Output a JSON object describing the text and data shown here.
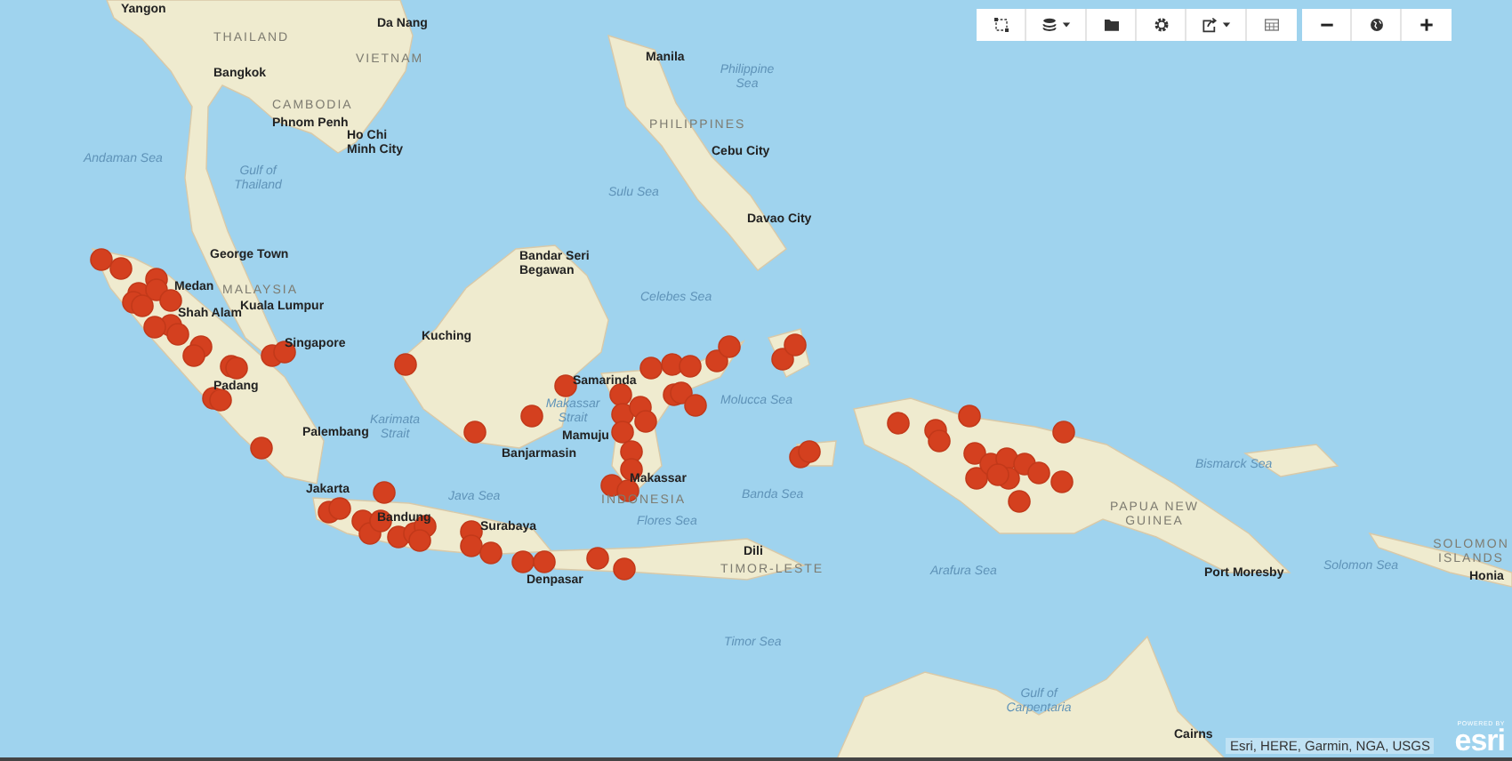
{
  "map": {
    "labels": [
      {
        "text": "Yangon",
        "kind": "city"
      },
      {
        "text": "Da Nang",
        "kind": "city"
      },
      {
        "text": "THAILAND",
        "kind": "country"
      },
      {
        "text": "VIETNAM",
        "kind": "country"
      },
      {
        "text": "Bangkok",
        "kind": "city"
      },
      {
        "text": "CAMBODIA",
        "kind": "country"
      },
      {
        "text": "Phnom Penh",
        "kind": "city"
      },
      {
        "text": "Ho Chi Minh City",
        "kind": "city"
      },
      {
        "text": "Andaman Sea",
        "kind": "sea"
      },
      {
        "text": "Gulf of Thailand",
        "kind": "sea"
      },
      {
        "text": "Manila",
        "kind": "city"
      },
      {
        "text": "Philippine Sea",
        "kind": "sea"
      },
      {
        "text": "PHILIPPINES",
        "kind": "country"
      },
      {
        "text": "Cebu City",
        "kind": "city"
      },
      {
        "text": "Sulu Sea",
        "kind": "sea"
      },
      {
        "text": "Davao City",
        "kind": "city"
      },
      {
        "text": "George Town",
        "kind": "city"
      },
      {
        "text": "MALAYSIA",
        "kind": "country"
      },
      {
        "text": "Medan",
        "kind": "city"
      },
      {
        "text": "Shah Alam",
        "kind": "city"
      },
      {
        "text": "Kuala Lumpur",
        "kind": "city"
      },
      {
        "text": "Bandar Seri Begawan",
        "kind": "city"
      },
      {
        "text": "Celebes Sea",
        "kind": "sea"
      },
      {
        "text": "Singapore",
        "kind": "city"
      },
      {
        "text": "Kuching",
        "kind": "city"
      },
      {
        "text": "Samarinda",
        "kind": "city"
      },
      {
        "text": "Molucca Sea",
        "kind": "sea"
      },
      {
        "text": "Padang",
        "kind": "city"
      },
      {
        "text": "Palembang",
        "kind": "city"
      },
      {
        "text": "Karimata Strait",
        "kind": "sea"
      },
      {
        "text": "Makassar Strait",
        "kind": "sea"
      },
      {
        "text": "Mamuju",
        "kind": "city"
      },
      {
        "text": "Banjarmasin",
        "kind": "city"
      },
      {
        "text": "Java Sea",
        "kind": "sea"
      },
      {
        "text": "Jakarta",
        "kind": "city"
      },
      {
        "text": "Bandung",
        "kind": "city"
      },
      {
        "text": "Makassar",
        "kind": "city"
      },
      {
        "text": "INDONESIA",
        "kind": "country"
      },
      {
        "text": "Flores Sea",
        "kind": "sea"
      },
      {
        "text": "Banda Sea",
        "kind": "sea"
      },
      {
        "text": "Surabaya",
        "kind": "city"
      },
      {
        "text": "Denpasar",
        "kind": "city"
      },
      {
        "text": "Dili",
        "kind": "city"
      },
      {
        "text": "TIMOR-LESTE",
        "kind": "country"
      },
      {
        "text": "Timor Sea",
        "kind": "sea"
      },
      {
        "text": "Arafura Sea",
        "kind": "sea"
      },
      {
        "text": "Bismarck Sea",
        "kind": "sea"
      },
      {
        "text": "PAPUA NEW GUINEA",
        "kind": "country"
      },
      {
        "text": "Solomon Sea",
        "kind": "sea"
      },
      {
        "text": "SOLOMON ISLANDS",
        "kind": "country"
      },
      {
        "text": "Port Moresby",
        "kind": "city"
      },
      {
        "text": "Honia",
        "kind": "city"
      },
      {
        "text": "Gulf of Carpentaria",
        "kind": "sea"
      },
      {
        "text": "Cairns",
        "kind": "city"
      }
    ]
  },
  "attribution": "Esri, HERE, Garmin, NGA, USGS",
  "logo": {
    "caption": "POWERED BY",
    "text": "esri"
  }
}
